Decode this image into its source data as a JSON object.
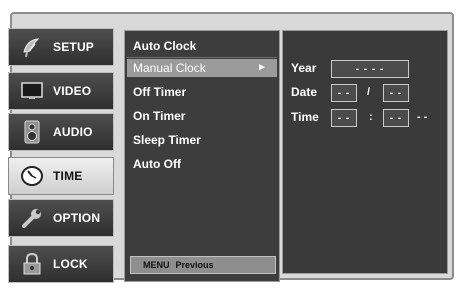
{
  "tabs": [
    {
      "label": "SETUP",
      "icon": "satellite-dish-icon",
      "active": false
    },
    {
      "label": "VIDEO",
      "icon": "monitor-icon",
      "active": false
    },
    {
      "label": "AUDIO",
      "icon": "speaker-icon",
      "active": false
    },
    {
      "label": "TIME",
      "icon": "clock-icon",
      "active": true
    },
    {
      "label": "OPTION",
      "icon": "wrench-icon",
      "active": false
    },
    {
      "label": "LOCK",
      "icon": "padlock-icon",
      "active": false
    }
  ],
  "menu": {
    "items": [
      {
        "label": "Auto Clock",
        "selected": false
      },
      {
        "label": "Manual Clock",
        "selected": true,
        "arrow": "►"
      },
      {
        "label": "Off Timer",
        "selected": false
      },
      {
        "label": "On Timer",
        "selected": false
      },
      {
        "label": "Sleep Timer",
        "selected": false
      },
      {
        "label": "Auto Off",
        "selected": false
      }
    ],
    "footer_key": "MENU",
    "footer_label": "Previous"
  },
  "settings": {
    "year_label": "Year",
    "year_value": "- - - -",
    "date_label": "Date",
    "date_month": "- -",
    "date_sep": "/",
    "date_day": "- -",
    "time_label": "Time",
    "time_hour": "- -",
    "time_sep": ":",
    "time_minute": "- -",
    "time_ampm": "- -"
  },
  "colors": {
    "panel_dark": "#3a3a3a",
    "frame": "#d9d9d9",
    "highlight": "#9b9b9b",
    "text": "#ffffff"
  }
}
